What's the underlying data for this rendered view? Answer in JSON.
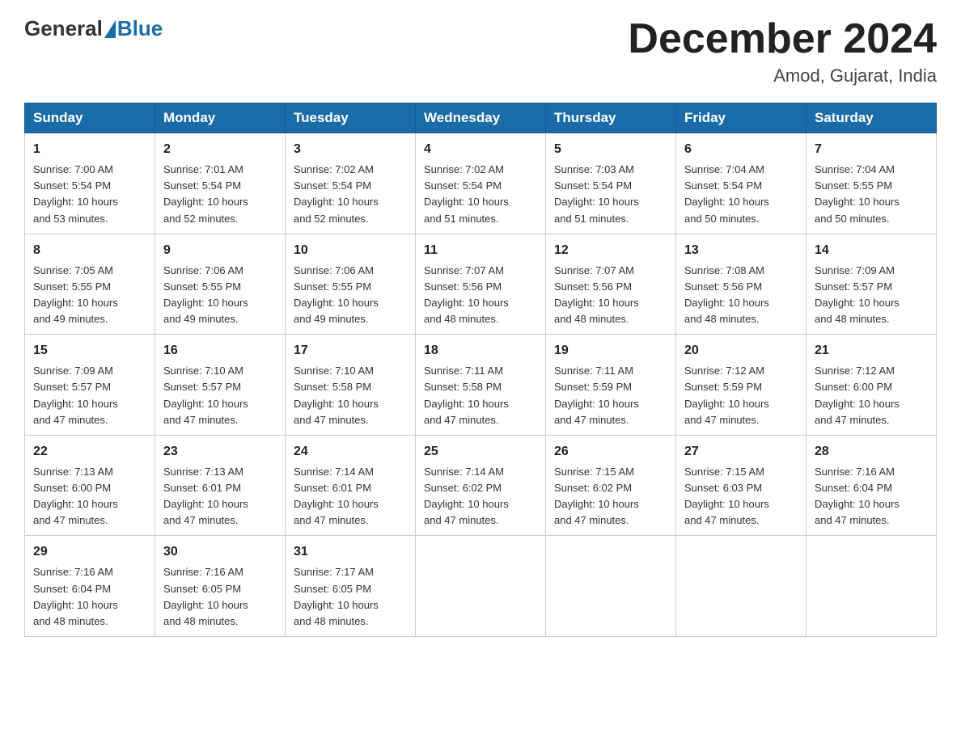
{
  "logo": {
    "text_general": "General",
    "text_blue": "Blue"
  },
  "header": {
    "month": "December 2024",
    "location": "Amod, Gujarat, India"
  },
  "weekdays": [
    "Sunday",
    "Monday",
    "Tuesday",
    "Wednesday",
    "Thursday",
    "Friday",
    "Saturday"
  ],
  "weeks": [
    [
      {
        "day": "1",
        "sunrise": "7:00 AM",
        "sunset": "5:54 PM",
        "daylight": "10 hours and 53 minutes."
      },
      {
        "day": "2",
        "sunrise": "7:01 AM",
        "sunset": "5:54 PM",
        "daylight": "10 hours and 52 minutes."
      },
      {
        "day": "3",
        "sunrise": "7:02 AM",
        "sunset": "5:54 PM",
        "daylight": "10 hours and 52 minutes."
      },
      {
        "day": "4",
        "sunrise": "7:02 AM",
        "sunset": "5:54 PM",
        "daylight": "10 hours and 51 minutes."
      },
      {
        "day": "5",
        "sunrise": "7:03 AM",
        "sunset": "5:54 PM",
        "daylight": "10 hours and 51 minutes."
      },
      {
        "day": "6",
        "sunrise": "7:04 AM",
        "sunset": "5:54 PM",
        "daylight": "10 hours and 50 minutes."
      },
      {
        "day": "7",
        "sunrise": "7:04 AM",
        "sunset": "5:55 PM",
        "daylight": "10 hours and 50 minutes."
      }
    ],
    [
      {
        "day": "8",
        "sunrise": "7:05 AM",
        "sunset": "5:55 PM",
        "daylight": "10 hours and 49 minutes."
      },
      {
        "day": "9",
        "sunrise": "7:06 AM",
        "sunset": "5:55 PM",
        "daylight": "10 hours and 49 minutes."
      },
      {
        "day": "10",
        "sunrise": "7:06 AM",
        "sunset": "5:55 PM",
        "daylight": "10 hours and 49 minutes."
      },
      {
        "day": "11",
        "sunrise": "7:07 AM",
        "sunset": "5:56 PM",
        "daylight": "10 hours and 48 minutes."
      },
      {
        "day": "12",
        "sunrise": "7:07 AM",
        "sunset": "5:56 PM",
        "daylight": "10 hours and 48 minutes."
      },
      {
        "day": "13",
        "sunrise": "7:08 AM",
        "sunset": "5:56 PM",
        "daylight": "10 hours and 48 minutes."
      },
      {
        "day": "14",
        "sunrise": "7:09 AM",
        "sunset": "5:57 PM",
        "daylight": "10 hours and 48 minutes."
      }
    ],
    [
      {
        "day": "15",
        "sunrise": "7:09 AM",
        "sunset": "5:57 PM",
        "daylight": "10 hours and 47 minutes."
      },
      {
        "day": "16",
        "sunrise": "7:10 AM",
        "sunset": "5:57 PM",
        "daylight": "10 hours and 47 minutes."
      },
      {
        "day": "17",
        "sunrise": "7:10 AM",
        "sunset": "5:58 PM",
        "daylight": "10 hours and 47 minutes."
      },
      {
        "day": "18",
        "sunrise": "7:11 AM",
        "sunset": "5:58 PM",
        "daylight": "10 hours and 47 minutes."
      },
      {
        "day": "19",
        "sunrise": "7:11 AM",
        "sunset": "5:59 PM",
        "daylight": "10 hours and 47 minutes."
      },
      {
        "day": "20",
        "sunrise": "7:12 AM",
        "sunset": "5:59 PM",
        "daylight": "10 hours and 47 minutes."
      },
      {
        "day": "21",
        "sunrise": "7:12 AM",
        "sunset": "6:00 PM",
        "daylight": "10 hours and 47 minutes."
      }
    ],
    [
      {
        "day": "22",
        "sunrise": "7:13 AM",
        "sunset": "6:00 PM",
        "daylight": "10 hours and 47 minutes."
      },
      {
        "day": "23",
        "sunrise": "7:13 AM",
        "sunset": "6:01 PM",
        "daylight": "10 hours and 47 minutes."
      },
      {
        "day": "24",
        "sunrise": "7:14 AM",
        "sunset": "6:01 PM",
        "daylight": "10 hours and 47 minutes."
      },
      {
        "day": "25",
        "sunrise": "7:14 AM",
        "sunset": "6:02 PM",
        "daylight": "10 hours and 47 minutes."
      },
      {
        "day": "26",
        "sunrise": "7:15 AM",
        "sunset": "6:02 PM",
        "daylight": "10 hours and 47 minutes."
      },
      {
        "day": "27",
        "sunrise": "7:15 AM",
        "sunset": "6:03 PM",
        "daylight": "10 hours and 47 minutes."
      },
      {
        "day": "28",
        "sunrise": "7:16 AM",
        "sunset": "6:04 PM",
        "daylight": "10 hours and 47 minutes."
      }
    ],
    [
      {
        "day": "29",
        "sunrise": "7:16 AM",
        "sunset": "6:04 PM",
        "daylight": "10 hours and 48 minutes."
      },
      {
        "day": "30",
        "sunrise": "7:16 AM",
        "sunset": "6:05 PM",
        "daylight": "10 hours and 48 minutes."
      },
      {
        "day": "31",
        "sunrise": "7:17 AM",
        "sunset": "6:05 PM",
        "daylight": "10 hours and 48 minutes."
      },
      null,
      null,
      null,
      null
    ]
  ],
  "labels": {
    "sunrise": "Sunrise:",
    "sunset": "Sunset:",
    "daylight": "Daylight:"
  }
}
